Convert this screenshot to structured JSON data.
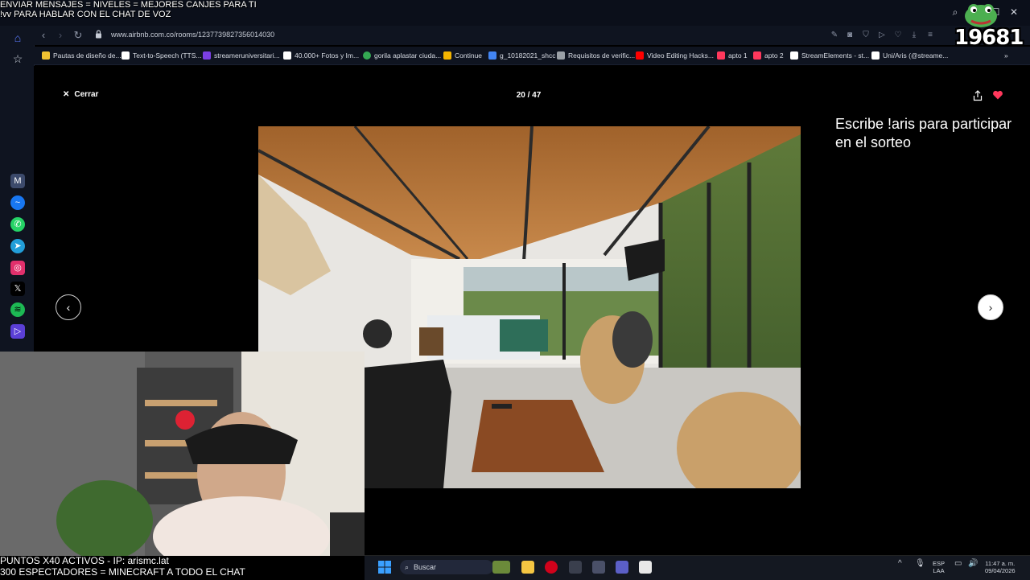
{
  "overlay": {
    "top_line1": "ENVIAR MENSAJES = NIVELES = MEJORES CANJES PARA TI",
    "top_line2": "!vv PARA HABLAR CON EL CHAT DE VOZ",
    "bottom_line1": "PUNTOS X40 ACTIVOS - IP: arismc.lat",
    "bottom_line2": "300 ESPECTADORES = MINECRAFT A TODO EL CHAT",
    "badge_number": "19681"
  },
  "browser": {
    "url": "www.airbnb.com.co/rooms/1237739827356014030",
    "bookmarks": [
      {
        "label": "Pautas de diseño de...",
        "icon_color": "#f1c232"
      },
      {
        "label": "Text-to-Speech (TTS...",
        "icon_color": "#ffffff"
      },
      {
        "label": "streameruniversitari...",
        "icon_color": "#7b3fe4"
      },
      {
        "label": "40.000+ Fotos y Im...",
        "icon_color": "#ffffff"
      },
      {
        "label": "gorila aplastar ciuda...",
        "icon_color": "#34a853"
      },
      {
        "label": "Continue",
        "icon_color": "#f4b400"
      },
      {
        "label": "g_10182021_shcc",
        "icon_color": "#4285f4"
      },
      {
        "label": "Requisitos de verific...",
        "icon_color": "#9aa0a6"
      },
      {
        "label": "Video Editing Hacks...",
        "icon_color": "#ff0000"
      },
      {
        "label": "apto 1",
        "icon_color": "#ff385c"
      },
      {
        "label": "apto 2",
        "icon_color": "#ff385c"
      },
      {
        "label": "StreamElements - st...",
        "icon_color": "#ffffff"
      },
      {
        "label": "Uni/Aris (@streame...",
        "icon_color": "#ffffff"
      }
    ]
  },
  "gallery": {
    "close_label": "Cerrar",
    "counter": "20 / 47",
    "prev_glyph": "‹",
    "next_glyph": "›"
  },
  "stream_text": {
    "sorteo": "Escribe !aris para participar en el sorteo"
  },
  "taskbar": {
    "search_label": "Buscar",
    "lang_line1": "ESP",
    "lang_line2": "LAA",
    "time": "11:47 a. m.",
    "date": "09/04/2026"
  }
}
